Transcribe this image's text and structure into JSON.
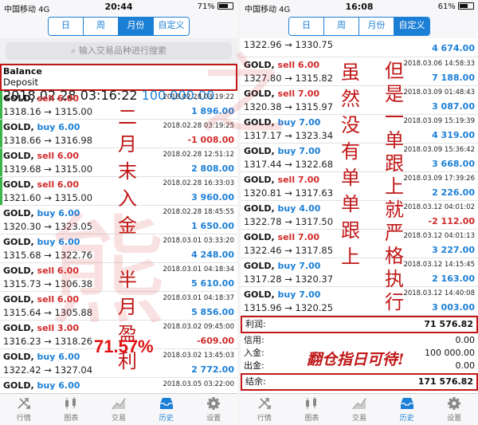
{
  "left": {
    "status": {
      "carrier": "中国移动  4G",
      "time": "20:44",
      "battery": "71%",
      "battery_level": 0.71
    },
    "tabs": [
      {
        "label": "日"
      },
      {
        "label": "周"
      },
      {
        "label": "月份",
        "active": true
      },
      {
        "label": "自定义"
      }
    ],
    "search": {
      "placeholder": "输入交易品种进行搜索"
    },
    "balance": {
      "title": "Balance",
      "type": "Deposit",
      "datetime": "2018.02.28 03:16:22",
      "amount": "100 000.00"
    },
    "trades": [
      {
        "symbol": "GOLD,",
        "side": "sell 6.00",
        "dir": "sell",
        "prices": "1318.16 → 1315.00",
        "datetime": "2018.02.28 03:19:22",
        "profit": "1 896.00",
        "sign": "pos"
      },
      {
        "symbol": "GOLD,",
        "side": "buy 6.00",
        "dir": "buy",
        "prices": "1318.66 → 1316.98",
        "datetime": "2018.02.28 03:19:25",
        "profit": "-1 008.00",
        "sign": "neg"
      },
      {
        "symbol": "GOLD,",
        "side": "sell 6.00",
        "dir": "sell",
        "prices": "1319.68 → 1315.00",
        "datetime": "2018.02.28 12:51:12",
        "profit": "2 808.00",
        "sign": "pos"
      },
      {
        "symbol": "GOLD,",
        "side": "sell 6.00",
        "dir": "sell",
        "prices": "1321.60 → 1315.00",
        "datetime": "2018.02.28 16:33:03",
        "profit": "3 960.00",
        "sign": "pos"
      },
      {
        "symbol": "GOLD,",
        "side": "buy 6.00",
        "dir": "buy",
        "prices": "1320.30 → 1323.05",
        "datetime": "2018.02.28 18:45:55",
        "profit": "1 650.00",
        "sign": "pos"
      },
      {
        "symbol": "GOLD,",
        "side": "buy 6.00",
        "dir": "buy",
        "prices": "1315.68 → 1322.76",
        "datetime": "2018.03.01 03:33:20",
        "profit": "4 248.00",
        "sign": "pos"
      },
      {
        "symbol": "GOLD,",
        "side": "sell 6.00",
        "dir": "sell",
        "prices": "1315.73 → 1306.38",
        "datetime": "2018.03.01 04:18:34",
        "profit": "5 610.00",
        "sign": "pos"
      },
      {
        "symbol": "GOLD,",
        "side": "sell 6.00",
        "dir": "sell",
        "prices": "1315.64 → 1305.88",
        "datetime": "2018.03.01 04:18:37",
        "profit": "5 856.00",
        "sign": "pos"
      },
      {
        "symbol": "GOLD,",
        "side": "sell 3.00",
        "dir": "sell",
        "prices": "1316.23 → 1318.26",
        "datetime": "2018.03.02 09:45:00",
        "profit": "-609.00",
        "sign": "neg"
      },
      {
        "symbol": "GOLD,",
        "side": "buy 6.00",
        "dir": "buy",
        "prices": "1322.42 → 1327.04",
        "datetime": "2018.03.02 13:45:03",
        "profit": "2 772.00",
        "sign": "pos"
      },
      {
        "symbol": "GOLD,",
        "side": "buy 6.00",
        "dir": "buy",
        "prices": "",
        "datetime": "2018.03.05 03:22:00",
        "profit": "",
        "sign": "pos"
      }
    ],
    "overlay_text": [
      "二",
      "月",
      "末",
      "入",
      "金",
      "",
      "半",
      "月",
      "盈",
      "利"
    ],
    "percent": "71.57%"
  },
  "right": {
    "status": {
      "carrier": "中国移动  4G",
      "time": "16:08",
      "battery": "61%",
      "battery_level": 0.61
    },
    "tabs": [
      {
        "label": "日"
      },
      {
        "label": "周"
      },
      {
        "label": "月份"
      },
      {
        "label": "自定义",
        "active": true
      }
    ],
    "trades": [
      {
        "symbol": "",
        "side": "",
        "dir": "buy",
        "prices": "1322.96 → 1330.75",
        "datetime": "",
        "profit": "4 674.00",
        "sign": "pos",
        "partial": true
      },
      {
        "symbol": "GOLD,",
        "side": "sell 6.00",
        "dir": "sell",
        "prices": "1327.80 → 1315.82",
        "datetime": "2018.03.06 14:58:33",
        "profit": "7 188.00",
        "sign": "pos"
      },
      {
        "symbol": "GOLD,",
        "side": "sell 7.00",
        "dir": "sell",
        "prices": "1320.38 → 1315.97",
        "datetime": "2018.03.09 01:48:43",
        "profit": "3 087.00",
        "sign": "pos"
      },
      {
        "symbol": "GOLD,",
        "side": "buy 7.00",
        "dir": "buy",
        "prices": "1317.17 → 1323.34",
        "datetime": "2018.03.09 15:19:39",
        "profit": "4 319.00",
        "sign": "pos"
      },
      {
        "symbol": "GOLD,",
        "side": "buy 7.00",
        "dir": "buy",
        "prices": "1317.44 → 1322.68",
        "datetime": "2018.03.09 15:36:42",
        "profit": "3 668.00",
        "sign": "pos"
      },
      {
        "symbol": "GOLD,",
        "side": "sell 7.00",
        "dir": "sell",
        "prices": "1320.81 → 1317.63",
        "datetime": "2018.03.09 17:39:26",
        "profit": "2 226.00",
        "sign": "pos"
      },
      {
        "symbol": "GOLD,",
        "side": "buy 4.00",
        "dir": "buy",
        "prices": "1322.78 → 1317.50",
        "datetime": "2018.03.12 04:01:02",
        "profit": "-2 112.00",
        "sign": "neg"
      },
      {
        "symbol": "GOLD,",
        "side": "sell 7.00",
        "dir": "sell",
        "prices": "1322.46 → 1317.85",
        "datetime": "2018.03.12 04:01:13",
        "profit": "3 227.00",
        "sign": "pos"
      },
      {
        "symbol": "GOLD,",
        "side": "buy 7.00",
        "dir": "buy",
        "prices": "1317.28 → 1320.37",
        "datetime": "2018.03.12 14:15:45",
        "profit": "2 163.00",
        "sign": "pos"
      },
      {
        "symbol": "GOLD,",
        "side": "buy 7.00",
        "dir": "buy",
        "prices": "1315.96 → 1320.25",
        "datetime": "2018.03.12 14:40:08",
        "profit": "3 003.00",
        "sign": "pos"
      }
    ],
    "summary": {
      "profit_label": "利润:",
      "profit_value": "71 576.82",
      "credit_label": "信用:",
      "credit_value": "0.00",
      "deposit_label": "入金:",
      "deposit_value": "100 000.00",
      "withdraw_label": "出金:",
      "withdraw_value": "0.00",
      "balance_label": "结余:",
      "balance_value": "171 576.82"
    },
    "overlay_col1": [
      "虽",
      "然",
      "没",
      "有",
      "单",
      "单",
      "跟",
      "上"
    ],
    "overlay_col2": [
      "但",
      "是",
      "一",
      "单",
      "跟",
      "上",
      "就",
      "严",
      "格",
      "执",
      "行"
    ],
    "slogan": "翻仓指日可待!"
  },
  "nav": [
    {
      "label": "行情",
      "icon": "quotes-icon"
    },
    {
      "label": "图表",
      "icon": "chart-candles-icon"
    },
    {
      "label": "交易",
      "icon": "trade-icon"
    },
    {
      "label": "历史",
      "icon": "history-inbox-icon",
      "active": true
    },
    {
      "label": "设置",
      "icon": "gear-icon"
    }
  ],
  "colors": {
    "accent": "#1c7fd6",
    "loss": "#d12a2a",
    "annotation": "#c01818"
  }
}
